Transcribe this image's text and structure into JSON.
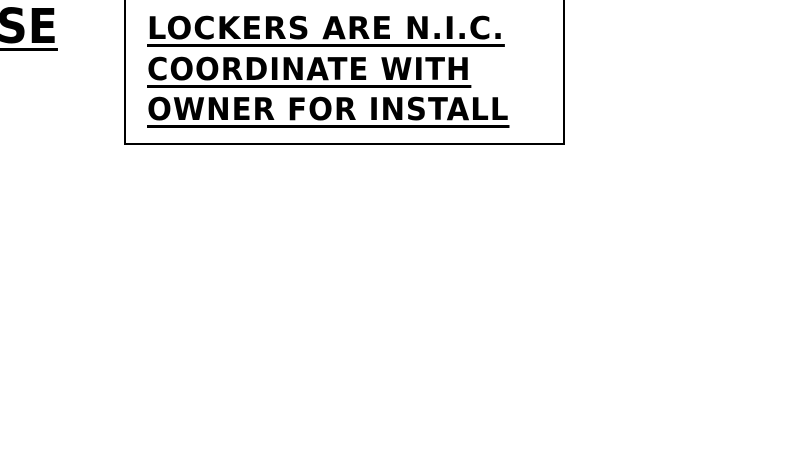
{
  "drawing": {
    "left_fragment": "SE",
    "note": {
      "lines": [
        "LOCKERS ARE N.I.C.",
        "COORDINATE WITH",
        "OWNER FOR INSTALL"
      ]
    }
  },
  "colors": {
    "ink": "#000000",
    "paper": "#ffffff"
  }
}
